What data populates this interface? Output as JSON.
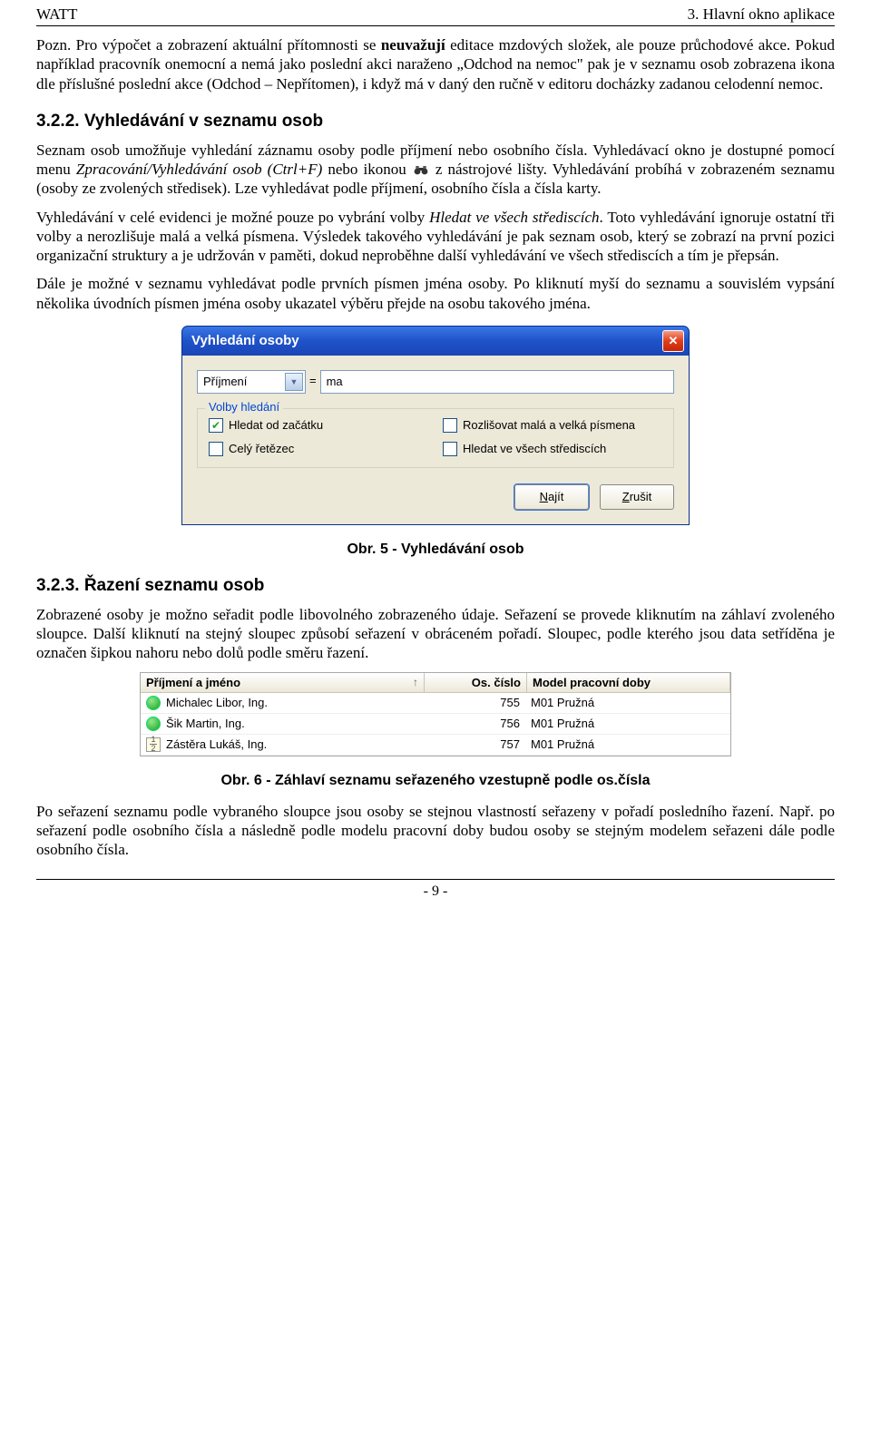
{
  "header": {
    "left": "WATT",
    "right": "3. Hlavní okno aplikace"
  },
  "para1_a": "Pozn. Pro výpočet a zobrazení aktuální přítomnosti se ",
  "para1_b_bold": "neuvažují",
  "para1_c": " editace mzdových složek, ale pouze průchodové akce. Pokud například pracovník onemocní a nemá jako poslední akci naraženo „Odchod na nemoc\" pak je v seznamu osob zobrazena ikona dle příslušné poslední akce (Odchod – Nepřítomen), i když má v daný den ručně v editoru docházky zadanou celodenní nemoc.",
  "sec322_title": "3.2.2. Vyhledávání v seznamu osob",
  "para2_a": "Seznam osob umožňuje vyhledání záznamu osoby podle příjmení nebo osobního čísla. Vyhledávací okno je dostupné pomocí menu ",
  "para2_b_italic": "Zpracování/Vyhledávání osob (Ctrl+F)",
  "para2_c": " nebo ikonou ",
  "para2_d": " z nástrojové lišty. Vyhledávání probíhá v zobrazeném seznamu (osoby ze zvolených středisek). Lze vyhledávat podle příjmení, osobního čísla a čísla karty.",
  "para3_a": "Vyhledávání v celé evidenci je možné pouze po vybrání volby ",
  "para3_b_italic": "Hledat ve všech střediscích",
  "para3_c": ". Toto vyhledávání ignoruje ostatní tři volby a nerozlišuje malá a velká písmena. Výsledek takového vyhledávání je pak seznam osob, který se zobrazí na první pozici organizační struktury a je udržován v paměti, dokud neproběhne další vyhledávání ve všech střediscích a tím je přepsán.",
  "para4": "Dále je možné v seznamu vyhledávat podle prvních písmen jména osoby. Po kliknutí myší do seznamu a souvislém vypsání několika úvodních písmen jména osoby ukazatel výběru přejde na osobu takového jména.",
  "dialog": {
    "title": "Vyhledání osoby",
    "field_select": "Příjmení",
    "eq": "=",
    "value": "ma",
    "legend": "Volby hledání",
    "opts": [
      {
        "label": "Hledat od začátku",
        "checked": true
      },
      {
        "label": "Rozlišovat malá a velká písmena",
        "checked": false
      },
      {
        "label": "Celý řetězec",
        "checked": false
      },
      {
        "label": "Hledat ve všech střediscích",
        "checked": false
      }
    ],
    "btn_find_u": "N",
    "btn_find_rest": "ajít",
    "btn_cancel_u": "Z",
    "btn_cancel_rest": "rušit"
  },
  "caption5": "Obr. 5 - Vyhledávání osob",
  "sec323_title": "3.2.3. Řazení seznamu osob",
  "para5": "Zobrazené osoby je možno seřadit podle libovolného zobrazeného údaje. Seřazení se provede kliknutím na záhlaví zvoleného sloupce. Další kliknutí na stejný sloupec způsobí seřazení v obráceném pořadí. Sloupec, podle kterého jsou data setříděna je označen šipkou nahoru nebo dolů podle směru řazení.",
  "table": {
    "h1": "Příjmení a jméno",
    "h2": "Os. číslo",
    "h3": "Model pracovní doby",
    "rows": [
      {
        "status": "green",
        "name": "Michalec Libor, Ing.",
        "num": "755",
        "model": "M01 Pružná"
      },
      {
        "status": "green",
        "name": "Šik Martin, Ing.",
        "num": "756",
        "model": "M01 Pružná"
      },
      {
        "status": "frac",
        "name": "Zástěra Lukáš, Ing.",
        "num": "757",
        "model": "M01 Pružná"
      }
    ]
  },
  "caption6": "Obr. 6 - Záhlaví seznamu seřazeného vzestupně podle os.čísla",
  "para6": "Po seřazení seznamu podle vybraného sloupce jsou osoby se stejnou vlastností seřazeny v pořadí posledního řazení. Např. po seřazení podle osobního čísla a následně podle modelu pracovní doby budou osoby se stejným modelem seřazeni dále podle osobního čísla.",
  "footer": "- 9 -"
}
